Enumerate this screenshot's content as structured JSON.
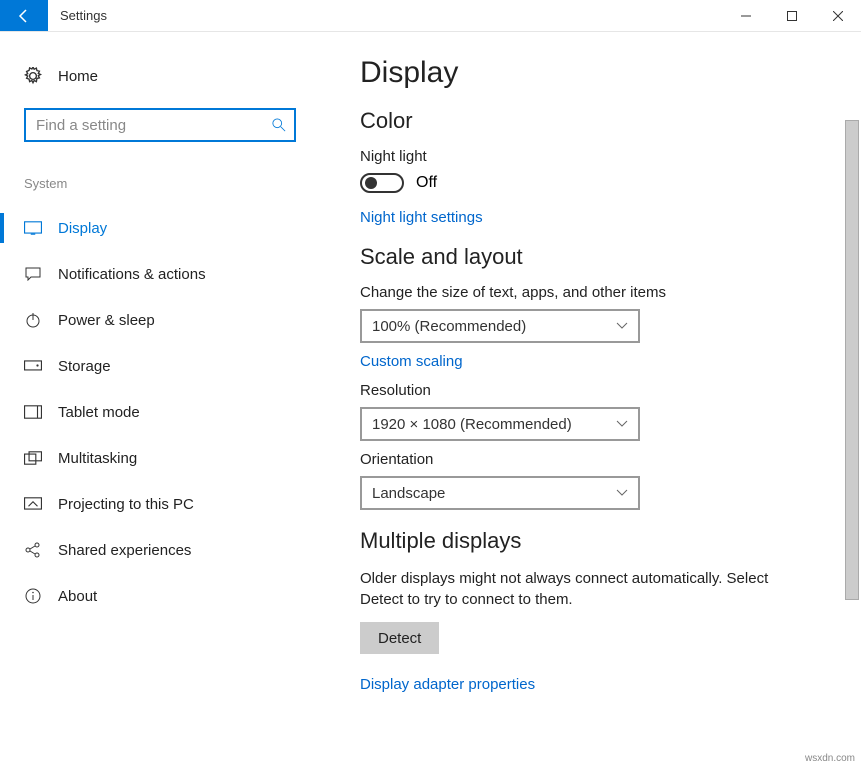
{
  "window": {
    "title": "Settings"
  },
  "sidebar": {
    "home": "Home",
    "search_placeholder": "Find a setting",
    "category": "System",
    "items": [
      {
        "label": "Display"
      },
      {
        "label": "Notifications & actions"
      },
      {
        "label": "Power & sleep"
      },
      {
        "label": "Storage"
      },
      {
        "label": "Tablet mode"
      },
      {
        "label": "Multitasking"
      },
      {
        "label": "Projecting to this PC"
      },
      {
        "label": "Shared experiences"
      },
      {
        "label": "About"
      }
    ]
  },
  "main": {
    "page_title": "Display",
    "color": {
      "heading": "Color",
      "night_light_label": "Night light",
      "night_light_state": "Off",
      "night_light_link": "Night light settings"
    },
    "scale": {
      "heading": "Scale and layout",
      "size_label": "Change the size of text, apps, and other items",
      "size_value": "100% (Recommended)",
      "custom_scaling_link": "Custom scaling",
      "resolution_label": "Resolution",
      "resolution_value": "1920 × 1080 (Recommended)",
      "orientation_label": "Orientation",
      "orientation_value": "Landscape"
    },
    "multiple": {
      "heading": "Multiple displays",
      "desc": "Older displays might not always connect automatically. Select Detect to try to connect to them.",
      "detect_btn": "Detect",
      "adapter_link": "Display adapter properties"
    }
  },
  "credit": "wsxdn.com"
}
